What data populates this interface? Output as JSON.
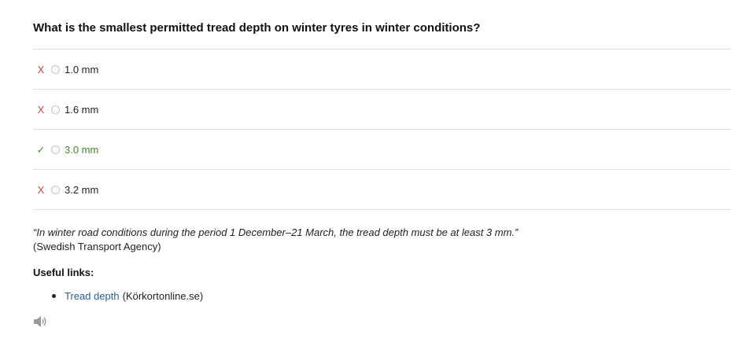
{
  "question": "What is the smallest permitted tread depth on winter tyres in winter conditions?",
  "options": [
    {
      "mark": "X",
      "label": "1.0 mm",
      "correct": false
    },
    {
      "mark": "X",
      "label": "1.6 mm",
      "correct": false
    },
    {
      "mark": "✓",
      "label": "3.0 mm",
      "correct": true
    },
    {
      "mark": "X",
      "label": "3.2 mm",
      "correct": false
    }
  ],
  "explanation": {
    "quote": "“In winter road conditions during the period 1 December–21 March, the tread depth must be at least 3 mm.”",
    "source": "(Swedish Transport Agency)"
  },
  "useful_links": {
    "title": "Useful links:",
    "items": [
      {
        "link_text": "Tread depth",
        "source": "(Körkortonline.se)"
      }
    ]
  },
  "icons": {
    "audio": "speaker-icon"
  },
  "colors": {
    "wrong": "#e0413c",
    "correct": "#3c9a2d",
    "link": "#2a5e93"
  }
}
